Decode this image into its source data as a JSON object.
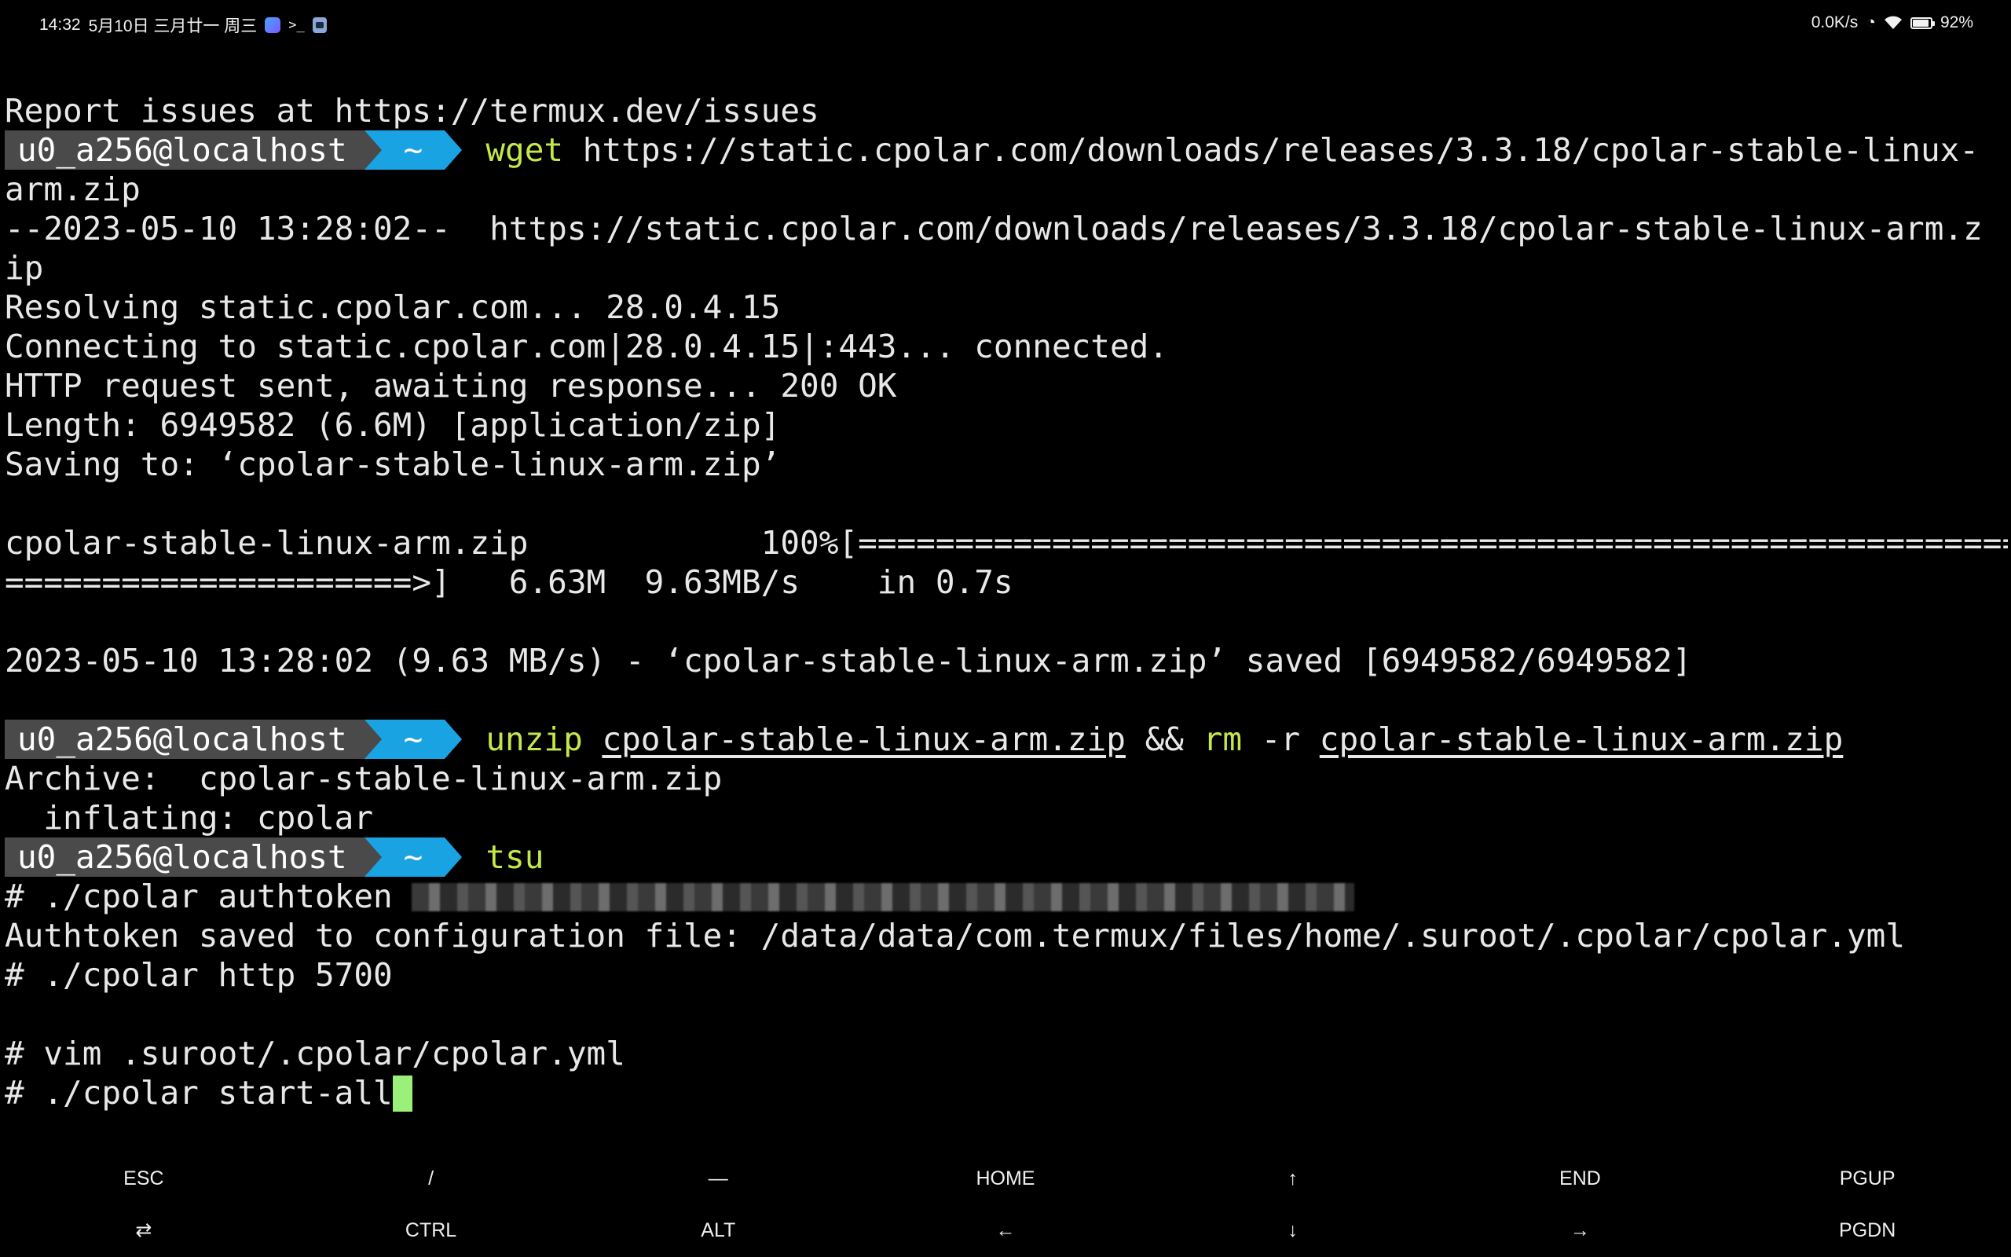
{
  "status_bar": {
    "time": "14:32",
    "date": "5月10日 三月廿一 周三",
    "net_speed": "0.0K/s",
    "battery": "92%",
    "battery_level": 0.92,
    "icons": [
      "app-icon",
      "terminal-icon",
      "app-icon",
      "data-icon",
      "wifi-icon",
      "battery-icon"
    ]
  },
  "prompt": {
    "user": "u0_a256@localhost",
    "dir": "~"
  },
  "terminal": {
    "lines": [
      {
        "type": "text",
        "text": "Report issues at https://termux.dev/issues"
      },
      {
        "type": "prompt",
        "cmd": "wget",
        "args": "https://static.cpolar.com/downloads/releases/3.3.18/cpolar-stable-linux-"
      },
      {
        "type": "text",
        "text": "arm.zip"
      },
      {
        "type": "text",
        "text": "--2023-05-10 13:28:02--  https://static.cpolar.com/downloads/releases/3.3.18/cpolar-stable-linux-arm.z"
      },
      {
        "type": "text",
        "text": "ip"
      },
      {
        "type": "text",
        "text": "Resolving static.cpolar.com... 28.0.4.15"
      },
      {
        "type": "text",
        "text": "Connecting to static.cpolar.com|28.0.4.15|:443... connected."
      },
      {
        "type": "text",
        "text": "HTTP request sent, awaiting response... 200 OK"
      },
      {
        "type": "text",
        "text": "Length: 6949582 (6.6M) [application/zip]"
      },
      {
        "type": "text",
        "text": "Saving to: ‘cpolar-stable-linux-arm.zip’"
      },
      {
        "type": "text",
        "text": ""
      },
      {
        "type": "text",
        "text": "cpolar-stable-linux-arm.zip            100%[====================================================================="
      },
      {
        "type": "text",
        "text": "=====================>]   6.63M  9.63MB/s    in 0.7s"
      },
      {
        "type": "text",
        "text": ""
      },
      {
        "type": "text",
        "text": "2023-05-10 13:28:02 (9.63 MB/s) - ‘cpolar-stable-linux-arm.zip’ saved [6949582/6949582]"
      },
      {
        "type": "text",
        "text": ""
      },
      {
        "type": "prompt_unzip",
        "cmd1": "unzip",
        "arg1": "cpolar-stable-linux-arm.zip",
        "op": "&&",
        "cmd2": "rm",
        "flag": "-r",
        "arg2": "cpolar-stable-linux-arm.zip"
      },
      {
        "type": "text",
        "text": "Archive:  cpolar-stable-linux-arm.zip"
      },
      {
        "type": "text",
        "text": "  inflating: cpolar"
      },
      {
        "type": "prompt",
        "cmd": "tsu",
        "args": ""
      },
      {
        "type": "redacted",
        "text": "# ./cpolar authtoken "
      },
      {
        "type": "text",
        "text": "Authtoken saved to configuration file: /data/data/com.termux/files/home/.suroot/.cpolar/cpolar.yml"
      },
      {
        "type": "text",
        "text": "# ./cpolar http 5700"
      },
      {
        "type": "text",
        "text": ""
      },
      {
        "type": "text",
        "text": "# vim .suroot/.cpolar/cpolar.yml"
      },
      {
        "type": "cursor",
        "text": "# ./cpolar start-all"
      }
    ]
  },
  "extra_keys": {
    "row1": [
      "ESC",
      "/",
      "—",
      "HOME",
      "↑",
      "END",
      "PGUP"
    ],
    "row2": [
      "⇄",
      "CTRL",
      "ALT",
      "←",
      "↓",
      "→",
      "PGDN"
    ]
  }
}
